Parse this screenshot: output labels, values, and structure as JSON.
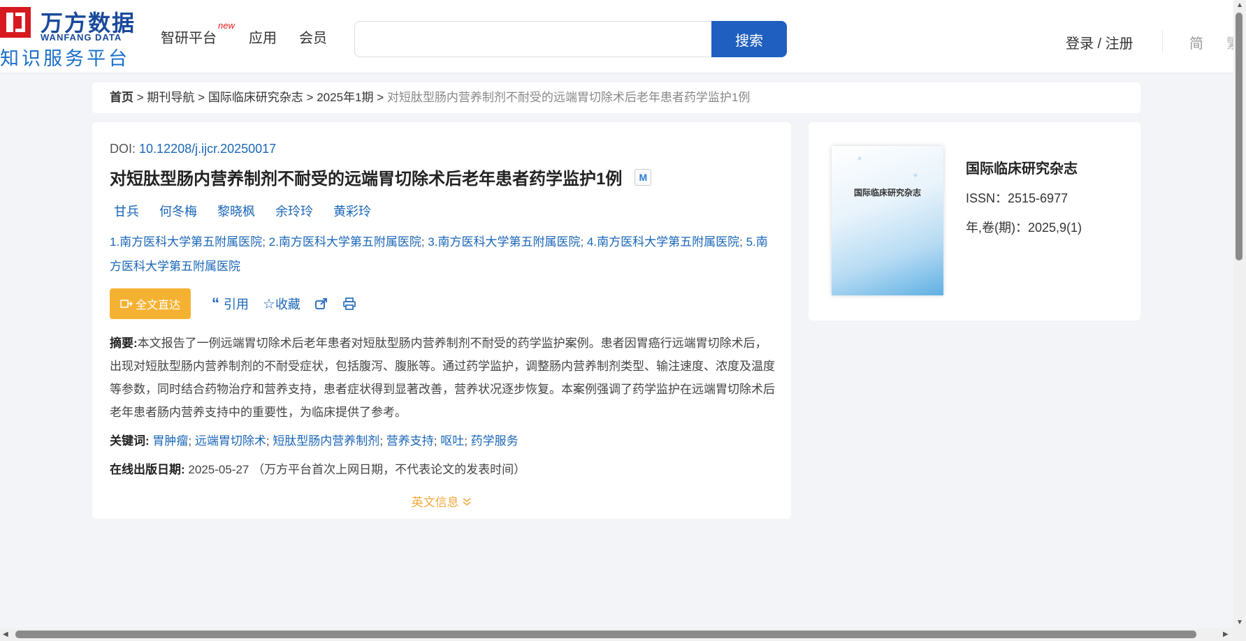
{
  "header": {
    "logo_cn": "万方数据",
    "logo_en": "WANFANG DATA",
    "logo_sub": "知识服务平台",
    "nav": [
      {
        "label": "智研平台",
        "badge": "new"
      },
      {
        "label": "应用"
      },
      {
        "label": "会员"
      }
    ],
    "search_placeholder": "",
    "search_button": "搜索",
    "login": "登录 / 注册",
    "lang": "简",
    "lang2": "繁"
  },
  "breadcrumb": {
    "items": [
      "首页",
      "期刊导航",
      "国际临床研究杂志",
      "2025年1期"
    ],
    "separator": ">",
    "current": "对短肽型肠内营养制剂不耐受的远端胃切除术后老年患者药学监护1例"
  },
  "article": {
    "doi_label": "DOI:",
    "doi": "10.12208/j.ijcr.20250017",
    "title": "对短肽型肠内营养制剂不耐受的远端胃切除术后老年患者药学监护1例",
    "badge": "M",
    "authors": [
      "甘兵",
      "何冬梅",
      "黎晓枫",
      "余玲玲",
      "黄彩玲"
    ],
    "affiliations": [
      "1.南方医科大学第五附属医院",
      "2.南方医科大学第五附属医院",
      "3.南方医科大学第五附属医院",
      "4.南方医科大学第五附属医院",
      "5.南方医科大学第五附属医院"
    ],
    "actions": {
      "full_text": "全文直达",
      "cite": "引用",
      "favorite": "收藏"
    },
    "abstract_label": "摘要:",
    "abstract": "本文报告了一例远端胃切除术后老年患者对短肽型肠内营养制剂不耐受的药学监护案例。患者因胃癌行远端胃切除术后，出现对短肽型肠内营养制剂的不耐受症状，包括腹泻、腹胀等。通过药学监护，调整肠内营养制剂类型、输注速度、浓度及温度等参数，同时结合药物治疗和营养支持，患者症状得到显著改善，营养状况逐步恢复。本案例强调了药学监护在远端胃切除术后老年患者肠内营养支持中的重要性，为临床提供了参考。",
    "keywords_label": "关键词:",
    "keywords": [
      "胃肿瘤",
      "远端胃切除术",
      "短肽型肠内营养制剂",
      "营养支持",
      "呕吐",
      "药学服务"
    ],
    "pubdate_label": "在线出版日期:",
    "pubdate": "2025-05-27",
    "pubdate_note": "（万方平台首次上网日期，不代表论文的发表时间）",
    "english_info": "英文信息"
  },
  "journal": {
    "cover_title": "国际临床研究杂志",
    "name": "国际临床研究杂志",
    "issn": "ISSN：2515-6977",
    "volume": "年,卷(期)：2025,9(1)"
  }
}
